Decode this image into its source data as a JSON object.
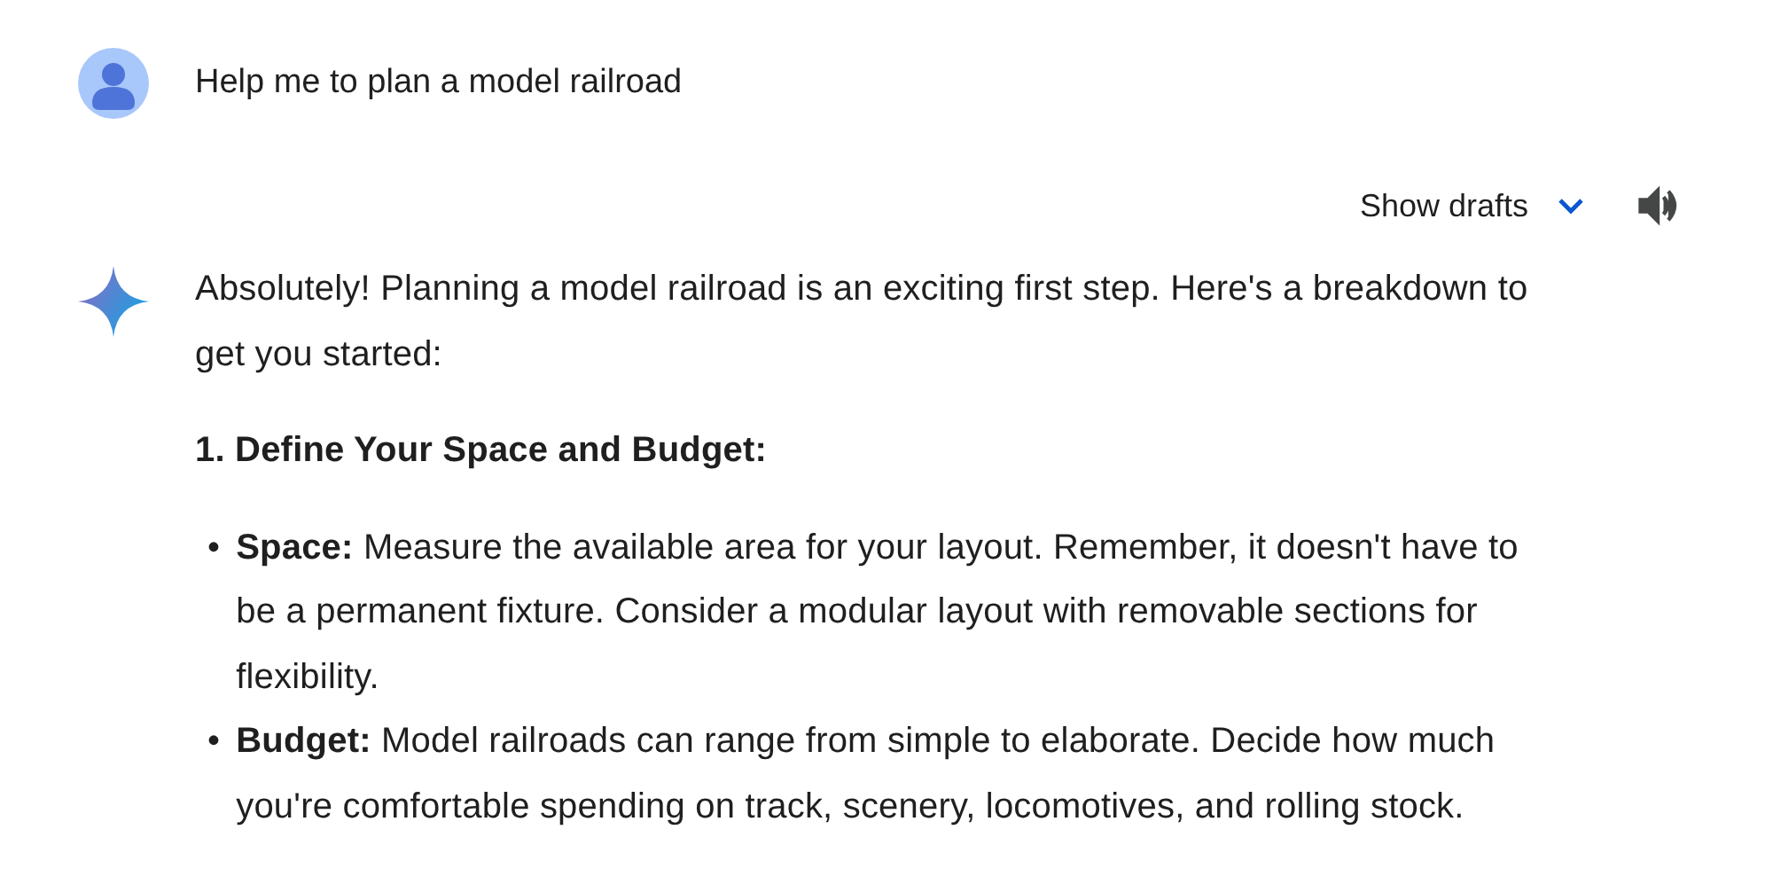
{
  "prompt": {
    "text": "Help me to plan a model railroad"
  },
  "drafts_button": {
    "label": "Show drafts"
  },
  "response": {
    "intro": "Absolutely! Planning a model railroad is an exciting first step. Here's a breakdown to get you started:",
    "heading": "1. Define Your Space and Budget:",
    "bullets": [
      {
        "marker": "•",
        "text": "**Space:** Measure the available area for your layout. Remember, it doesn't have to be a permanent fixture. Consider a modular layout with removable sections for flexibility."
      },
      {
        "marker": "•",
        "text": "**Budget:** Model railroads can range from simple to elaborate. Decide how much you're comfortable spending on track, scenery, locomotives, and rolling stock."
      }
    ]
  }
}
